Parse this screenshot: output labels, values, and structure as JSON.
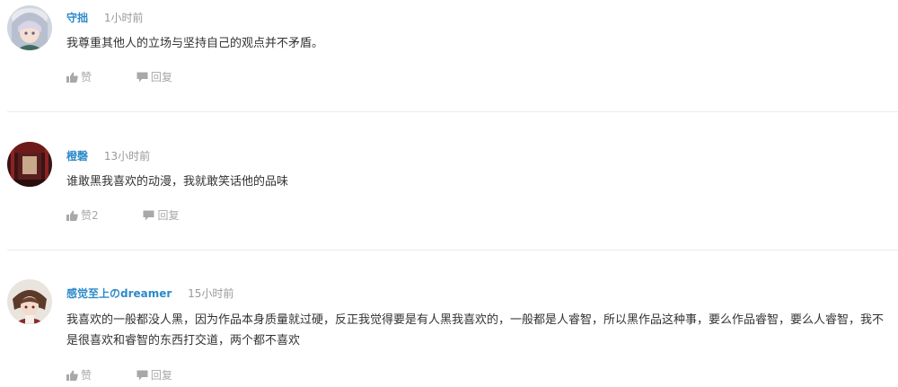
{
  "comments": [
    {
      "username": "守拙",
      "time": "1小时前",
      "content": "我尊重其他人的立场与坚持自己的观点并不矛盾。",
      "like_label": "赞",
      "reply_label": "回复"
    },
    {
      "username": "橙磬",
      "time": "13小时前",
      "content": "谁敢黑我喜欢的动漫，我就敢笑话他的品味",
      "like_label": "赞2",
      "reply_label": "回复"
    },
    {
      "username": "感觉至上のdreamer",
      "time": "15小时前",
      "content": "我喜欢的一般都没人黑，因为作品本身质量就过硬，反正我觉得要是有人黑我喜欢的，一般都是人睿智，所以黑作品这种事，要么作品睿智，要么人睿智，我不是很喜欢和睿智的东西打交道，两个都不喜欢",
      "like_label": "赞",
      "reply_label": "回复"
    }
  ],
  "colors": {
    "username": "#2d8ac9",
    "time": "#999999",
    "action": "#a8a8a8",
    "divider": "#ebebeb"
  },
  "icons": {
    "like": "thumbs-up-icon",
    "reply": "speech-bubble-icon"
  }
}
